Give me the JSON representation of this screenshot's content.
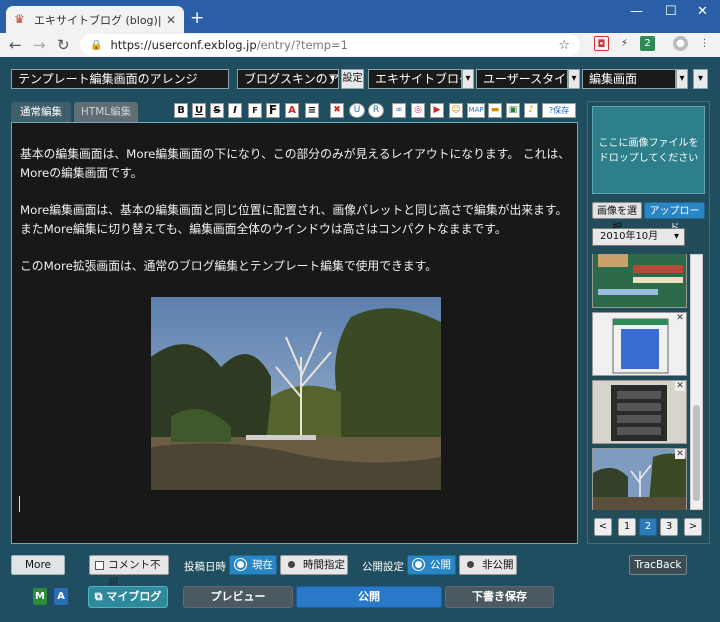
{
  "browser": {
    "tab_title": "エキサイトブログ (blog)|新規投稿",
    "url_host": "https://userconf.exblog.jp",
    "url_path": "/entry/?temp=1",
    "ext_badge": "2"
  },
  "top": {
    "template_name": "テンプレート編集画面のアレンジ",
    "skin_select": "ブログスキンのア",
    "settings_label": "設定",
    "blog_select": "エキサイトブログ",
    "user_style_select": "ユーザースタイル:",
    "screen_select": "編集画面"
  },
  "tabs": {
    "normal": "通常編集",
    "html": "HTML編集"
  },
  "format": {
    "bold": "B",
    "underline": "U",
    "strike": "S",
    "italic": "I",
    "font_small": "F",
    "font_large": "F",
    "color": "A",
    "align": "≡",
    "clear": "✖",
    "undo": "U",
    "redo": "R",
    "link": "∞",
    "insta": "◎",
    "youtube": "▶",
    "emoji": "☺",
    "map": "MAP",
    "folder": "▬",
    "book": "▣",
    "bell": "♪",
    "save": "?保存"
  },
  "editor": {
    "para1": "基本の編集画面は、More編集画面の下になり、この部分のみが見えるレイアウトになります。 これは、",
    "para1b": "Moreの編集画面です。",
    "para2": "More編集画面は、基本の編集画面と同じ位置に配置され、画像パレットと同じ高さで編集が出来ます。",
    "para2b": "またMore編集に切り替えても、編集画面全体のウインドウは高さはコンパクトなままです。",
    "para3": "このMore拡張画面は、通常のブログ編集とテンプレート編集で使用できます。"
  },
  "right_panel": {
    "drop_line1": "ここに画像ファイルを",
    "drop_line2": "ドロップしてください",
    "select_image": "画像を選択",
    "upload": "アップロード",
    "month": "2010年10月",
    "pages": [
      "<",
      "1",
      "2",
      "3",
      ">"
    ],
    "current_page": "2"
  },
  "bottom": {
    "more": "More",
    "no_comment": "コメント不可",
    "post_time_label": "投稿日時",
    "now": "現在",
    "specify_time": "時間指定",
    "public_label": "公開設定",
    "public": "公開",
    "private": "非公開",
    "trackback": "TracBack",
    "m": "M",
    "a": "A",
    "myblog": "マイブログ",
    "preview": "プレビュー",
    "publish": "公開",
    "draft": "下書き保存"
  },
  "colors": {
    "page_bg": "#1f4e60",
    "accent_blue": "#2a86c2",
    "editor_bg": "#181818",
    "tabbar": "#2a5fa8"
  }
}
